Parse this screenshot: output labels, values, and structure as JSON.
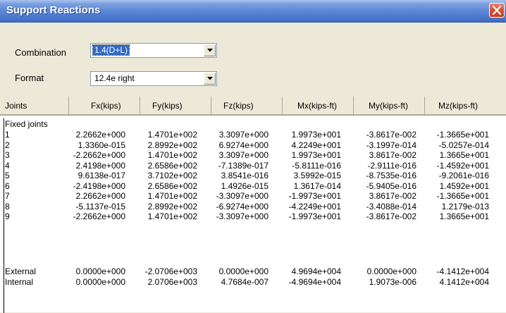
{
  "window": {
    "title": "Support Reactions"
  },
  "combination": {
    "label": "Combination",
    "value": "1.4(D+L)"
  },
  "format": {
    "label": "Format",
    "value": "12.4e right"
  },
  "columns": [
    "Joints",
    "Fx(kips)",
    "Fy(kips)",
    "Fz(kips)",
    "Mx(kips-ft)",
    "My(kips-ft)",
    "Mz(kips-ft)"
  ],
  "group_label": "Fixed joints",
  "rows": [
    [
      "1",
      "2.2662e+000",
      "1.4701e+002",
      "3.3097e+000",
      "1.9973e+001",
      "-3.8617e-002",
      "-1.3665e+001"
    ],
    [
      "2",
      "1.3360e-015",
      "2.8992e+002",
      "6.9274e+000",
      "4.2249e+001",
      "-3.1997e-014",
      "-5.0257e-014"
    ],
    [
      "3",
      "-2.2662e+000",
      "1.4701e+002",
      "3.3097e+000",
      "1.9973e+001",
      "3.8617e-002",
      "1.3665e+001"
    ],
    [
      "4",
      "2.4198e+000",
      "2.6586e+002",
      "-7.1389e-017",
      "-5.8111e-016",
      "-2.9111e-016",
      "-1.4592e+001"
    ],
    [
      "5",
      "9.6138e-017",
      "3.7102e+002",
      "3.8541e-016",
      "3.5992e-015",
      "-8.7535e-016",
      "-9.2061e-016"
    ],
    [
      "6",
      "-2.4198e+000",
      "2.6586e+002",
      "1.4926e-015",
      "1.3617e-014",
      "-5.9405e-016",
      "1.4592e+001"
    ],
    [
      "7",
      "2.2662e+000",
      "1.4701e+002",
      "-3.3097e+000",
      "-1.9973e+001",
      "3.8617e-002",
      "-1.3665e+001"
    ],
    [
      "8",
      "-5.1137e-015",
      "2.8992e+002",
      "-6.9274e+000",
      "-4.2249e+001",
      "-3.4088e-014",
      "1.2179e-013"
    ],
    [
      "9",
      "-2.2662e+000",
      "1.4701e+002",
      "-3.3097e+000",
      "-1.9973e+001",
      "-3.8617e-002",
      "1.3665e+001"
    ]
  ],
  "totals": [
    [
      "External",
      "0.0000e+000",
      "-2.0706e+003",
      "0.0000e+000",
      "4.9694e+004",
      "0.0000e+000",
      "-4.1412e+004"
    ],
    [
      "Internal",
      "0.0000e+000",
      "2.0706e+003",
      "4.7684e-007",
      "-4.9694e+004",
      "1.9073e-006",
      "4.1412e+004"
    ]
  ],
  "colors": {
    "titlebar": "#4a76cc",
    "selection": "#316ac5",
    "close": "#d85234",
    "face": "#ece9d8"
  },
  "icons": {
    "close": "close-icon",
    "dropdown": "chevron-down-icon"
  }
}
